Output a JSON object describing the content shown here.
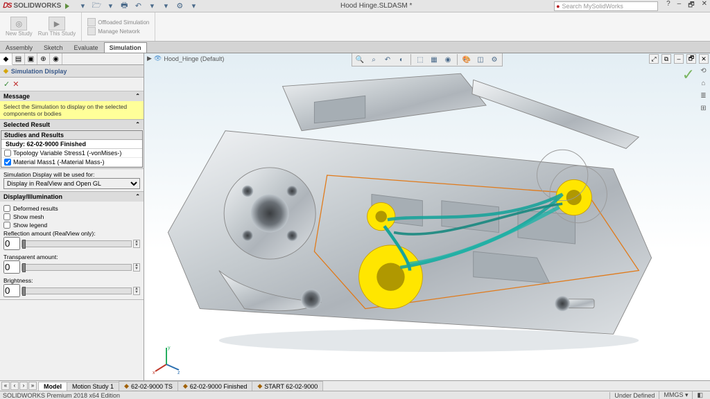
{
  "app": {
    "name": "SOLIDWORKS",
    "doc_title": "Hood Hinge.SLDASM *"
  },
  "search": {
    "placeholder": "Search MySolidWorks"
  },
  "ribbon": {
    "new_study": "New Study",
    "run_this_study": "Run This Study",
    "offloaded": "Offloaded Simulation",
    "manage_network": "Manage Network"
  },
  "mode_tabs": [
    "Assembly",
    "Sketch",
    "Evaluate",
    "Simulation"
  ],
  "active_mode_tab": 3,
  "panel": {
    "title": "Simulation Display",
    "message_head": "Message",
    "message_body": "Select the Simulation to display on the selected components or bodies",
    "selected_head": "Selected Result",
    "tree_head": "Studies and Results",
    "study_label": "Study:  62-02-9000 Finished",
    "result_topology": "Topology Variable Stress1 (-vonMises-)",
    "result_mass": "Material Mass1 (-Material Mass-)",
    "used_for_head": "Simulation Display will be used for:",
    "used_for_value": "Display in RealView and Open GL",
    "illum_head": "Display/Illumination",
    "deformed": "Deformed results",
    "show_mesh": "Show mesh",
    "show_legend": "Show legend",
    "reflection_label": "Reflection amount (RealView only):",
    "reflection_val": "0",
    "transparent_label": "Transparent amount:",
    "transparent_val": "0",
    "brightness_label": "Brightness:",
    "brightness_val": "0"
  },
  "viewport": {
    "crumb": "Hood_Hinge  (Default)"
  },
  "bottom_tabs": {
    "model": "Model",
    "motion": "Motion Study 1",
    "ts": "62-02-9000 TS",
    "finished": "62-02-9000 Finished",
    "start": "START 62-02-9000"
  },
  "status": {
    "edition": "SOLIDWORKS Premium 2018 x64 Edition",
    "under_defined": "Under Defined",
    "units": "MMGS",
    "custom": "◧"
  }
}
